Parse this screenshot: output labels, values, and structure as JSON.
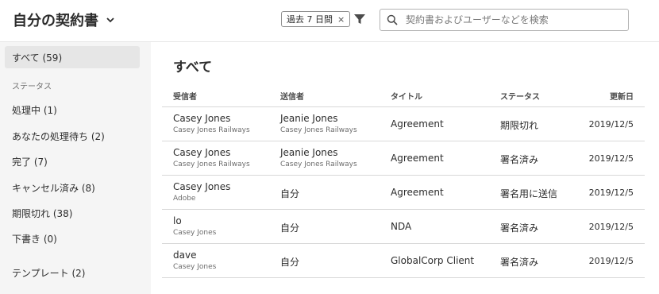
{
  "header": {
    "title": "自分の契約書",
    "filter_chip": "過去 7 日間",
    "filter_chip_close": "×",
    "search_placeholder": "契約書およびユーザーなどを検索"
  },
  "sidebar": {
    "items_top": [
      {
        "label": "すべて (59)",
        "active": true
      }
    ],
    "status_heading": "ステータス",
    "status_items": [
      {
        "label": "処理中 (1)"
      },
      {
        "label": "あなたの処理待ち (2)"
      },
      {
        "label": "完了 (7)"
      },
      {
        "label": "キャンセル済み (8)"
      },
      {
        "label": "期限切れ (38)"
      },
      {
        "label": "下書き (0)"
      }
    ],
    "templates_item": {
      "label": "テンプレート (2)"
    }
  },
  "main": {
    "title": "すべて",
    "columns": [
      "受信者",
      "送信者",
      "タイトル",
      "ステータス",
      "更新日"
    ],
    "rows": [
      {
        "recipient": "Casey Jones",
        "recipient_org": "Casey Jones Railways",
        "sender": "Jeanie Jones",
        "sender_org": "Casey Jones Railways",
        "title": "Agreement",
        "status": "期限切れ",
        "date": "2019/12/5"
      },
      {
        "recipient": "Casey Jones",
        "recipient_org": "Casey Jones Railways",
        "sender": "Jeanie Jones",
        "sender_org": "Casey Jones Railways",
        "title": "Agreement",
        "status": "署名済み",
        "date": "2019/12/5"
      },
      {
        "recipient": "Casey Jones",
        "recipient_org": "Adobe",
        "sender": "自分",
        "sender_org": "",
        "title": "Agreement",
        "status": "署名用に送信",
        "date": "2019/12/5"
      },
      {
        "recipient": "lo",
        "recipient_org": "Casey Jones",
        "sender": "自分",
        "sender_org": "",
        "title": "NDA",
        "status": "署名済み",
        "date": "2019/12/5"
      },
      {
        "recipient": "dave",
        "recipient_org": "Casey Jones",
        "sender": "自分",
        "sender_org": "",
        "title": "GlobalCorp Client",
        "status": "署名済み",
        "date": "2019/12/5"
      }
    ]
  }
}
